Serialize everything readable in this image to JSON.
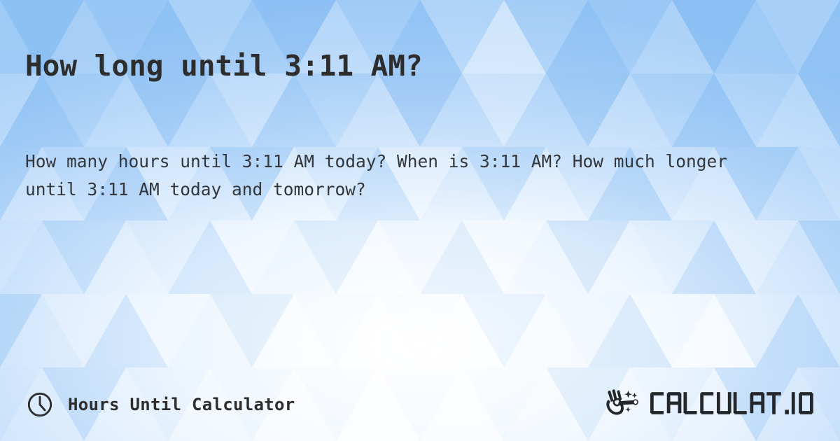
{
  "page": {
    "headline": "How long until 3:11 AM?",
    "description": "How many hours until 3:11 AM today? When is 3:11 AM? How much longer until 3:11 AM today and tomorrow?",
    "target_time": "3:11 AM"
  },
  "footer": {
    "tool_name": "Hours Until Calculator",
    "clock_icon": "clock-icon",
    "brand_name": "CALCULAT.IO",
    "brand_icon": "magic-wand-hand-icon"
  },
  "colors": {
    "background_base": "#a3cdf7",
    "background_light": "#ffffff",
    "text_primary": "#2d2d2d",
    "text_secondary": "#33373b",
    "logo": "#2b2f33"
  }
}
